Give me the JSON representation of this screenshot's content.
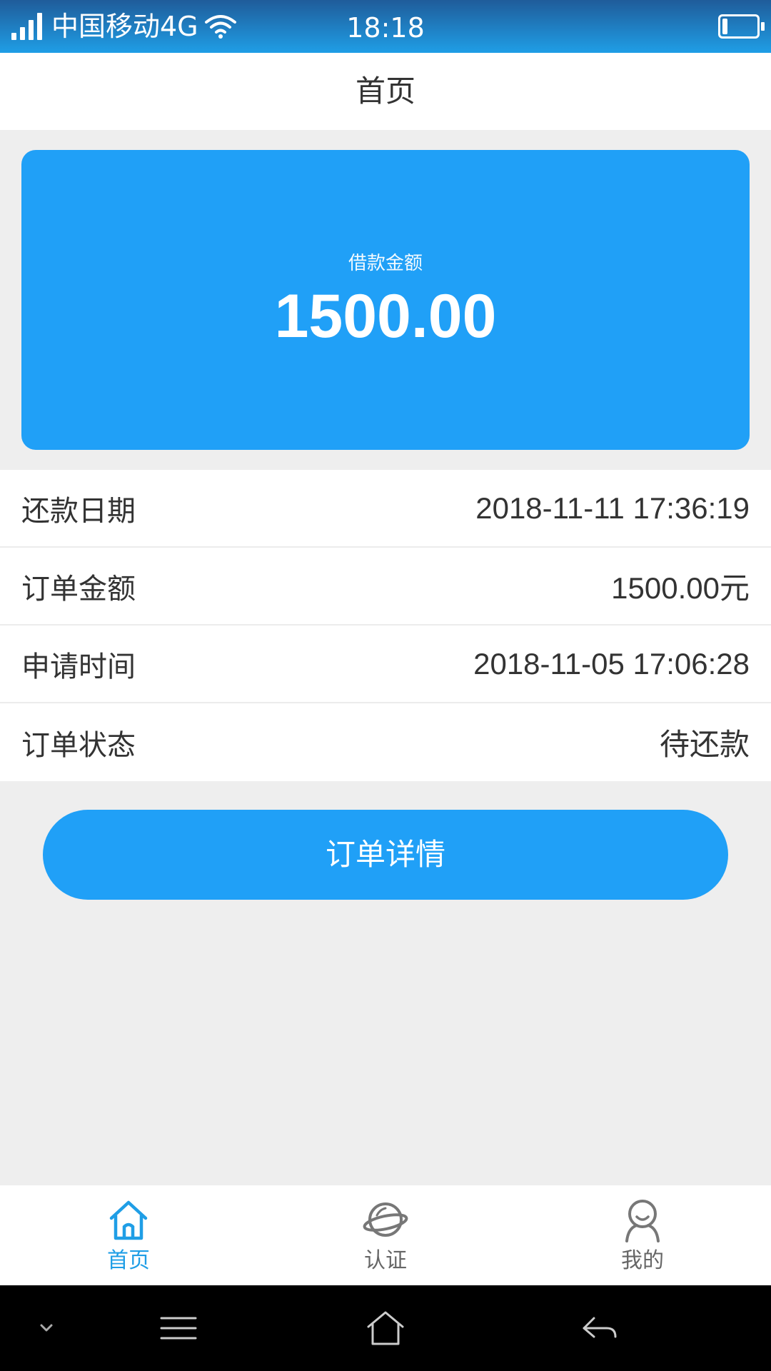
{
  "status_bar": {
    "carrier": "中国移动4G",
    "time": "18:18",
    "battery_level": 0.15,
    "icons": [
      "signal-icon",
      "wifi-icon",
      "battery-icon"
    ]
  },
  "header": {
    "title": "首页"
  },
  "loan_card": {
    "label": "借款金额",
    "amount": "1500.00",
    "color": "#20a0f7"
  },
  "info_rows": [
    {
      "label": "还款日期",
      "value": "2018-11-11 17:36:19"
    },
    {
      "label": "订单金额",
      "value": "1500.00元"
    },
    {
      "label": "申请时间",
      "value": "2018-11-05 17:06:28"
    },
    {
      "label": "订单状态",
      "value": "待还款"
    }
  ],
  "detail_button": {
    "label": "订单详情"
  },
  "tab_bar": {
    "tabs": [
      {
        "label": "首页",
        "icon": "home-icon",
        "active": true
      },
      {
        "label": "认证",
        "icon": "planet-icon",
        "active": false
      },
      {
        "label": "我的",
        "icon": "user-icon",
        "active": false
      }
    ],
    "active_color": "#1f9ee6"
  },
  "system_nav": {
    "icons": [
      "chevron-down-icon",
      "menu-icon",
      "home-icon",
      "back-icon"
    ]
  }
}
